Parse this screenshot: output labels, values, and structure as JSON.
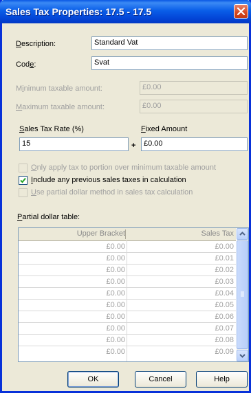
{
  "window": {
    "title": "Sales Tax Properties: 17.5 - 17.5"
  },
  "description": {
    "label_pre": "",
    "label_u": "D",
    "label_post": "escription:",
    "value": "Standard Vat"
  },
  "code": {
    "label_pre": "Cod",
    "label_u": "e",
    "label_post": ":",
    "value": "Svat"
  },
  "min_taxable": {
    "label_pre": "M",
    "label_u": "i",
    "label_post": "nimum taxable amount:",
    "value": "£0.00"
  },
  "max_taxable": {
    "label_pre": "",
    "label_u": "M",
    "label_post": "aximum taxable amount:",
    "value": "£0.00"
  },
  "rate": {
    "label_pre": "",
    "label_u": "S",
    "label_post": "ales Tax Rate (%)",
    "value": "15"
  },
  "fixed": {
    "label_pre": "",
    "label_u": "F",
    "label_post": "ixed Amount",
    "value": "£0.00"
  },
  "plus_sign": "+",
  "options": {
    "only_apply": {
      "label_pre": "",
      "label_u": "O",
      "label_post": "nly apply tax to portion over minimum taxable amount",
      "checked": false,
      "enabled": false
    },
    "include_previous": {
      "label_pre": "",
      "label_u": "I",
      "label_post": "nclude any previous sales taxes in calculation",
      "checked": true,
      "enabled": true
    },
    "partial_method": {
      "label_pre": "",
      "label_u": "U",
      "label_post": "se partial dollar method in sales tax calculation",
      "checked": false,
      "enabled": false
    }
  },
  "partial_table": {
    "label_pre": "",
    "label_u": "P",
    "label_post": "artial dollar table:",
    "columns": [
      "Upper Bracket",
      "Sales Tax"
    ],
    "rows": [
      [
        "£0.00",
        "£0.00"
      ],
      [
        "£0.00",
        "£0.01"
      ],
      [
        "£0.00",
        "£0.02"
      ],
      [
        "£0.00",
        "£0.03"
      ],
      [
        "£0.00",
        "£0.04"
      ],
      [
        "£0.00",
        "£0.05"
      ],
      [
        "£0.00",
        "£0.06"
      ],
      [
        "£0.00",
        "£0.07"
      ],
      [
        "£0.00",
        "£0.08"
      ],
      [
        "£0.00",
        "£0.09"
      ]
    ]
  },
  "buttons": {
    "ok": "OK",
    "cancel": "Cancel",
    "help": "Help"
  },
  "colors": {
    "title_bar": "#0a5ee8",
    "window_bg": "#ece9d8",
    "disabled_text": "#a0a0a0",
    "close_button": "#d5461f"
  },
  "icons": {
    "close": "close-icon",
    "check": "checkmark-icon",
    "scroll_up": "scroll-up-arrow-icon",
    "scroll_down": "scroll-down-arrow-icon"
  }
}
